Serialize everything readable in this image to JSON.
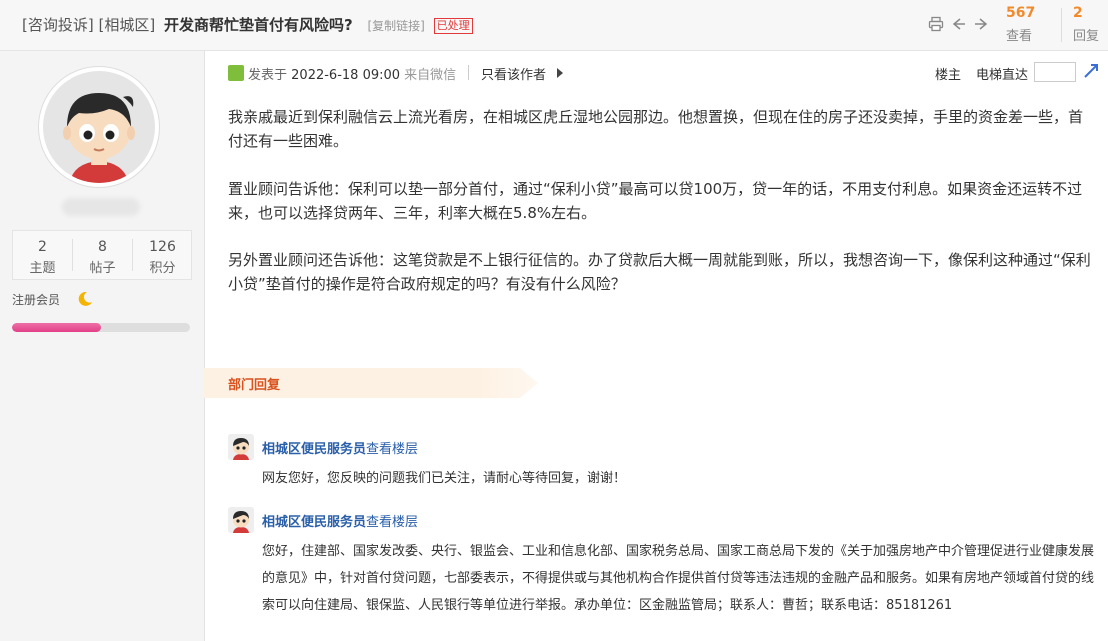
{
  "thread": {
    "category": "[咨询投诉]",
    "district": "[相城区]",
    "subject": "开发商帮忙垫首付有风险吗?",
    "copy_link": "[复制链接]",
    "status_badge": "已处理",
    "views": "567",
    "views_label": "查看",
    "replies": "2",
    "replies_label": "回复"
  },
  "icons": {
    "print": "print-icon",
    "prev": "prev-thread-icon",
    "next": "next-thread-icon",
    "jump": "go-floor-icon"
  },
  "author": {
    "stats": [
      {
        "value": "2",
        "label": "主题"
      },
      {
        "value": "8",
        "label": "帖子"
      },
      {
        "value": "126",
        "label": "积分"
      }
    ],
    "role": "注册会员",
    "level_progress": 0.5
  },
  "post": {
    "posted_prefix": "发表于",
    "posted_date": "2022-6-18 09:00",
    "source": "来自微信",
    "only_author": "只看该作者",
    "floor": "楼主",
    "elevator": "电梯直达",
    "paragraphs": [
      "我亲戚最近到保利融信云上流光看房，在相城区虎丘湿地公园那边。他想置换，但现在住的房子还没卖掉，手里的资金差一些，首付还有一些困难。",
      "置业顾问告诉他：保利可以垫一部分首付，通过“保利小贷”最高可以贷100万，贷一年的话，不用支付利息。如果资金还运转不过来，也可以选择贷两年、三年，利率大概在5.8%左右。",
      "另外置业顾问还告诉他：这笔贷款是不上银行征信的。办了贷款后大概一周就能到账，所以，我想咨询一下，像保利这种通过“保利小贷”垫首付的操作是符合政府规定的吗？有没有什么风险？"
    ]
  },
  "dept_reply": {
    "header": "部门回复",
    "replies": [
      {
        "name": "相城区便民服务员",
        "view_floor": "查看楼层",
        "text": "网友您好，您反映的问题我们已关注，请耐心等待回复，谢谢！"
      },
      {
        "name": "相城区便民服务员",
        "view_floor": "查看楼层",
        "text": "您好，住建部、国家发改委、央行、银监会、工业和信息化部、国家税务总局、国家工商总局下发的《关于加强房地产中介管理促进行业健康发展的意见》中，针对首付贷问题，七部委表示，不得提供或与其他机构合作提供首付贷等违法违规的金融产品和服务。如果有房地产领域首付贷的线索可以向住建局、银保监、人民银行等单位进行举报。承办单位：区金融监管局；联系人：曹哲；联系电话：85181261"
      }
    ]
  }
}
